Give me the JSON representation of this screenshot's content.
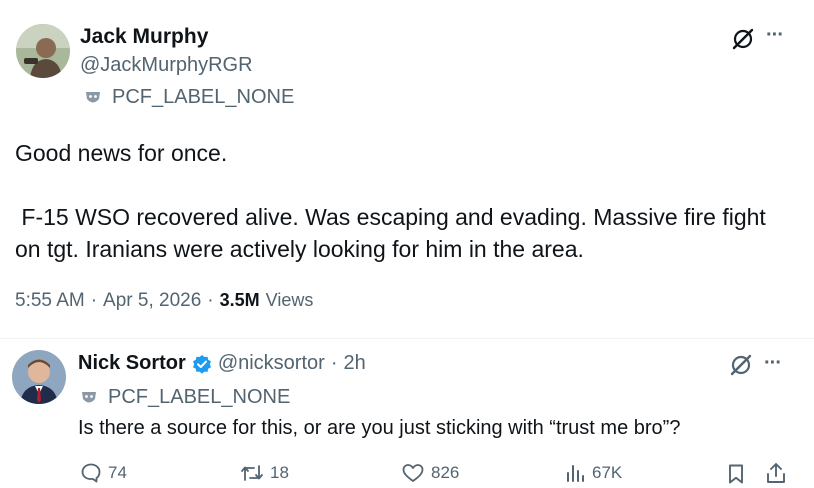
{
  "main_post": {
    "author_name": "Jack Murphy",
    "handle": "@JackMurphyRGR",
    "label": "PCF_LABEL_NONE",
    "text_line1": "Good news for once.",
    "text_line2": " F-15 WSO recovered alive. Was escaping and evading. Massive fire fight",
    "text_line3": "on tgt. Iranians were actively looking for him in the area.",
    "time": "5:55 AM",
    "sep1": "·",
    "date": "Apr 5, 2026",
    "sep2": "·",
    "views_count": "3.5M",
    "views_label": "Views",
    "more": "···"
  },
  "reply": {
    "author_name": "Nick Sortor",
    "handle": "@nicksortor",
    "sep": "·",
    "age": "2h",
    "label": "PCF_LABEL_NONE",
    "text": "Is there a source for this, or are you just sticking with “trust me bro”?",
    "more": "···",
    "stats": {
      "replies": "74",
      "reposts": "18",
      "likes": "826",
      "views": "67K"
    }
  },
  "colors": {
    "text": "#0f1419",
    "muted": "#536471",
    "verified": "#1d9bf0",
    "divider": "#eff3f4"
  }
}
